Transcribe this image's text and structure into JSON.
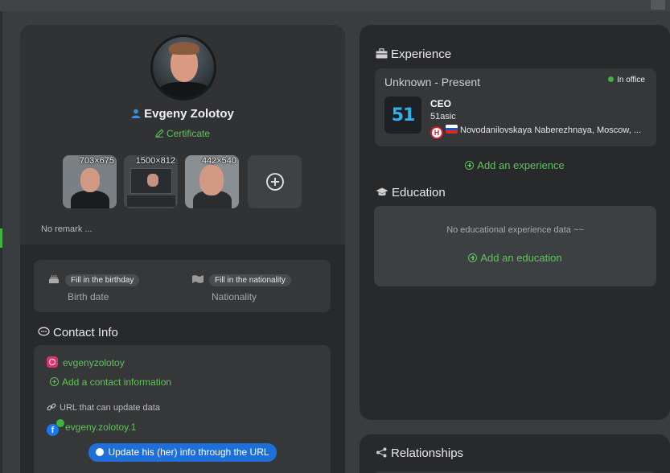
{
  "profile": {
    "name": "Evgeny Zolotoy",
    "certificate_label": "Certificate",
    "photos": [
      {
        "dims": "703×675"
      },
      {
        "dims": "1500×812"
      },
      {
        "dims": "442×540"
      }
    ],
    "remark": "No remark ..."
  },
  "personal_info": {
    "birthday_pill": "Fill in the birthday",
    "birthday_label": "Birth date",
    "nationality_pill": "Fill in the nationality",
    "nationality_label": "Nationality"
  },
  "contact": {
    "title": "Contact Info",
    "instagram_handle": "evgenyzolotoy",
    "add_contact_label": "Add a contact information",
    "url_label": "URL that can update data",
    "facebook_handle": "evgeny.zolotoy.1",
    "update_button": "Update his (her) info through the URL"
  },
  "experience": {
    "title": "Experience",
    "period": "Unknown - Present",
    "status": "In office",
    "logo_text": "51",
    "role": "CEO",
    "company": "51asic",
    "location_badge": "H",
    "location": "Novodanilovskaya Naberezhnaya, Moscow, ...",
    "add_label": "Add an experience"
  },
  "education": {
    "title": "Education",
    "empty_text": "No educational experience data ~~",
    "add_label": "Add an education"
  },
  "relationships": {
    "title": "Relationships"
  },
  "colors": {
    "accent_green": "#5fc45a",
    "button_blue": "#1f6fd9",
    "card_bg": "#27292b"
  }
}
